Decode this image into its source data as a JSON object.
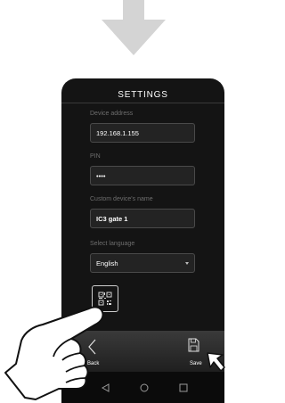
{
  "screen": {
    "title": "SETTINGS",
    "status_bar": ""
  },
  "form": {
    "device_address": {
      "label": "Device address",
      "value": "192.168.1.155"
    },
    "pin": {
      "label": "PIN",
      "value": "••••"
    },
    "device_name": {
      "label": "Custom device's name",
      "value": "IC3 gate 1"
    },
    "language": {
      "label": "Select language",
      "selected": "English"
    }
  },
  "qr_button": {
    "icon": "qr-scan-icon"
  },
  "bottom_bar": {
    "back_label": "Back",
    "save_label": "Save"
  },
  "nav_bar": {
    "icons": [
      "nav-back-icon",
      "nav-home-icon",
      "nav-recent-icon"
    ]
  },
  "overlay": {
    "arrow_icon": "down-arrow-icon",
    "hand_icon": "pointing-hand-icon",
    "cursor_icon": "mouse-cursor-icon"
  }
}
